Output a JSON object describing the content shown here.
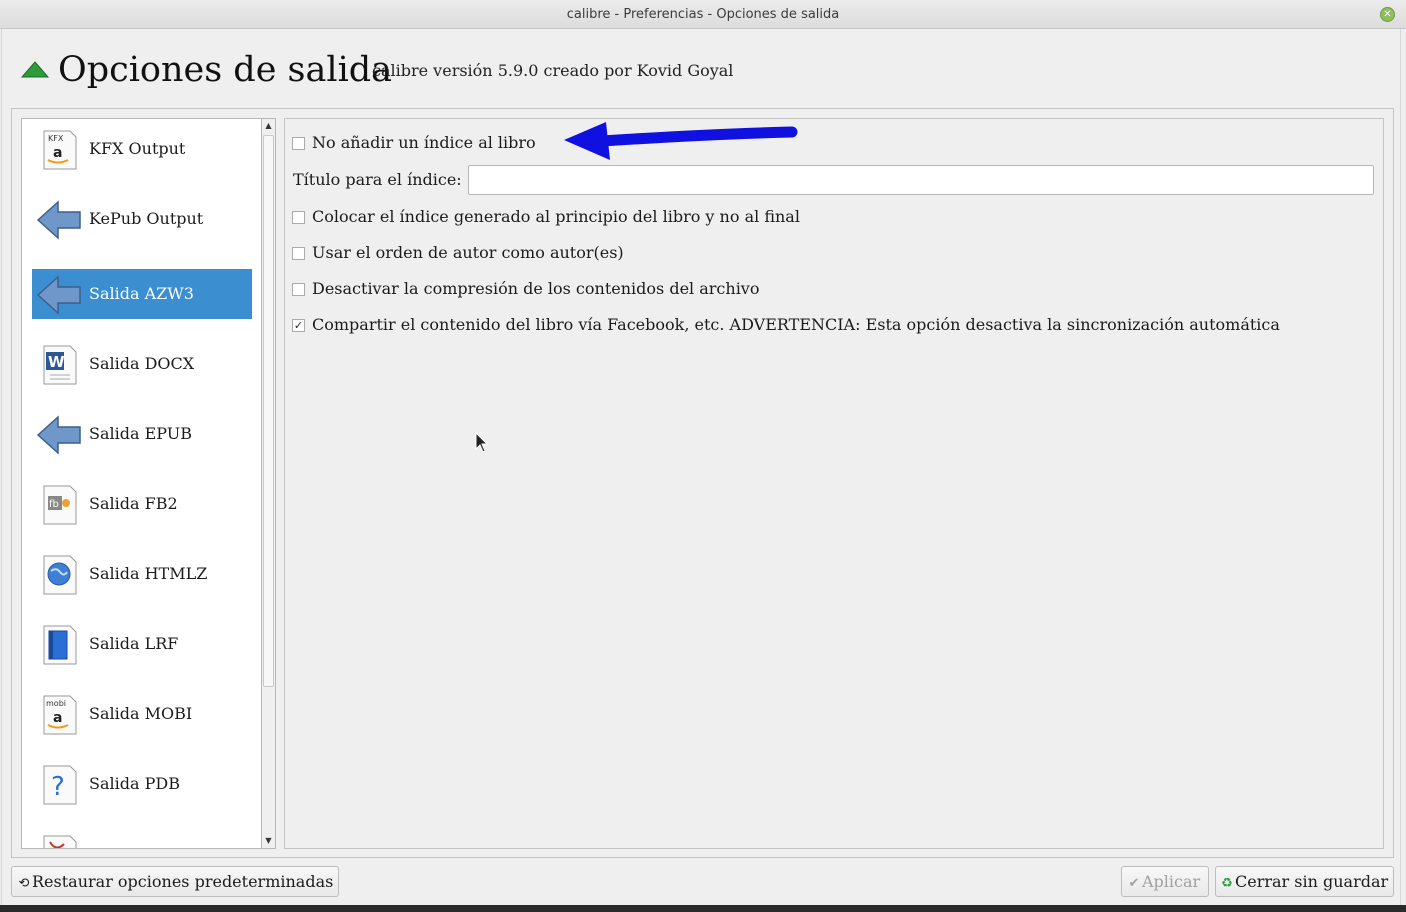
{
  "window": {
    "title": "calibre - Preferencias - Opciones de salida",
    "close_glyph": "✕"
  },
  "header": {
    "title": "Opciones de salida",
    "version": "calibre versión 5.9.0 creado por Kovid Goyal",
    "icon": "green-up-arrow-icon"
  },
  "sidebar": {
    "items": [
      {
        "label": "KFX Output",
        "icon": "kfx-amazon-icon",
        "badge": "KFX",
        "glyph": "a"
      },
      {
        "label": "KePub Output",
        "icon": "blue-left-arrow-icon"
      },
      {
        "label": "Salida AZW3",
        "icon": "blue-left-arrow-icon",
        "selected": true
      },
      {
        "label": "Salida DOCX",
        "icon": "word-document-icon",
        "glyph": "W"
      },
      {
        "label": "Salida EPUB",
        "icon": "blue-left-arrow-icon"
      },
      {
        "label": "Salida FB2",
        "icon": "fb2-document-icon",
        "glyph": "fb"
      },
      {
        "label": "Salida HTMLZ",
        "icon": "globe-document-icon"
      },
      {
        "label": "Salida LRF",
        "icon": "lrf-book-icon"
      },
      {
        "label": "Salida MOBI",
        "icon": "mobi-amazon-icon",
        "badge": "mobi",
        "glyph": "a"
      },
      {
        "label": "Salida PDB",
        "icon": "question-document-icon",
        "glyph": "?"
      }
    ],
    "scroll_up": "▲",
    "scroll_down": "▼"
  },
  "options": {
    "no_toc": {
      "label": "No añadir un índice al libro",
      "checked": false
    },
    "toc_title": {
      "label": "Título para el índice:",
      "value": ""
    },
    "toc_at_start": {
      "label": "Colocar el índice generado al principio del libro y no al final",
      "checked": false
    },
    "author_sort": {
      "label": "Usar el orden de autor como autor(es)",
      "checked": false
    },
    "no_compression": {
      "label": "Desactivar la compresión de los contenidos del archivo",
      "checked": false
    },
    "share_facebook": {
      "label": "Compartir el contenido del libro vía Facebook, etc. ADVERTENCIA: Esta opción desactiva la sincronización automática",
      "checked": true
    },
    "check_glyph": "✓"
  },
  "footer": {
    "restore": {
      "label": "Restaurar opciones predeterminadas",
      "icon": "restore-icon",
      "glyph": "⟲"
    },
    "apply": {
      "label": "Aplicar",
      "icon": "check-icon",
      "glyph": "✔",
      "disabled": true
    },
    "close": {
      "label": "Cerrar sin guardar",
      "icon": "recycle-icon",
      "glyph": "♻"
    }
  },
  "colors": {
    "selection": "#3b8fd0",
    "annotation_arrow": "#1010e0",
    "header_arrow": "#2e9a3a"
  }
}
